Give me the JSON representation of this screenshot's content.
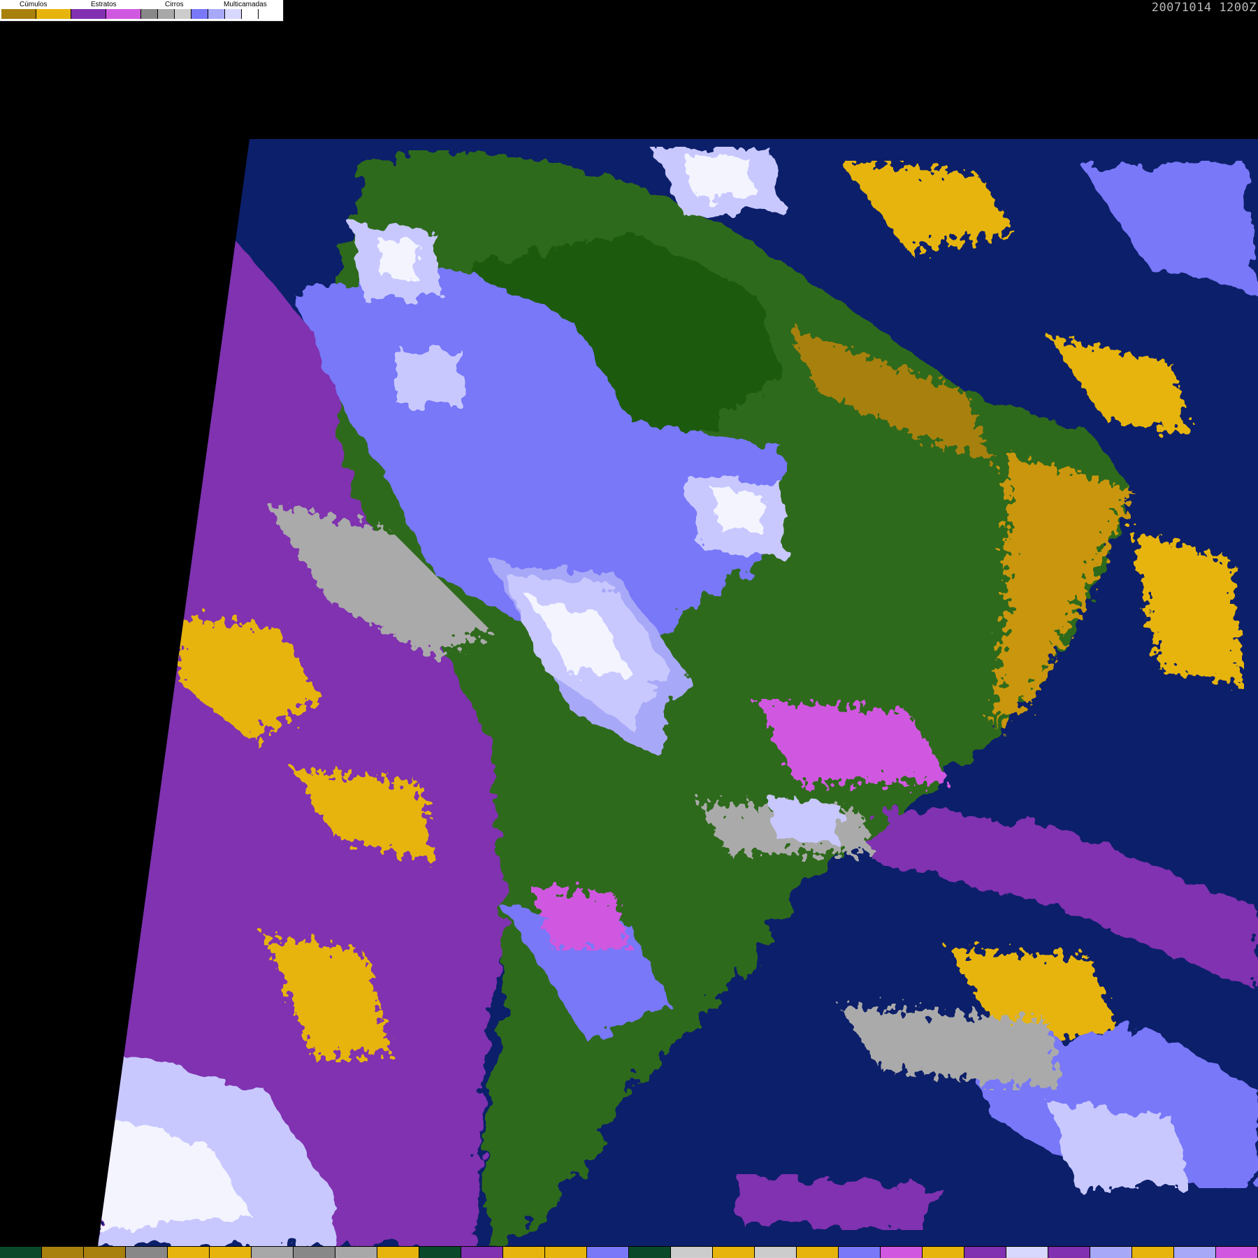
{
  "legend": {
    "groups": [
      {
        "label": "Cúmulos",
        "colors": [
          "#a8800c",
          "#e6b40c"
        ]
      },
      {
        "label": "Estratos",
        "colors": [
          "#8030b0",
          "#d058e0"
        ]
      },
      {
        "label": "Cirros",
        "colors": [
          "#888888",
          "#a8a8a8",
          "#cccccc"
        ]
      },
      {
        "label": "Multicamadas",
        "colors": [
          "#7878f8",
          "#a8a8f8",
          "#d8d8ff",
          "#ffffff"
        ]
      }
    ]
  },
  "timestamp": "20071014 1200Z",
  "palette": {
    "ocean": "#0c1f6a",
    "land": "#2f6a1e",
    "forest": "#1f5a10",
    "stratus": "#8030b0",
    "stratus_light": "#d058e0",
    "cumulus": "#e6b40c",
    "cumulus_dark": "#a8800c",
    "cirrus": "#aaaaaa",
    "multi": "#7878f8",
    "multi_light": "#c8c8ff",
    "cloud_white": "#f4f4ff",
    "background": "#000000"
  },
  "bottom_strip": [
    "#0a4a2a",
    "#a8800c",
    "#a8800c",
    "#888888",
    "#e6b40c",
    "#e6b40c",
    "#a8a8a8",
    "#888888",
    "#a8a8a8",
    "#e6b40c",
    "#0a4a2a",
    "#8030b0",
    "#e6b40c",
    "#e6b40c",
    "#7878f8",
    "#0a4a2a",
    "#cccccc",
    "#e6b40c",
    "#cccccc",
    "#e6b40c",
    "#7878f8",
    "#d058e0",
    "#e6b40c",
    "#8030b0",
    "#d8d8ff",
    "#8030b0",
    "#a8a8f8",
    "#e6b40c",
    "#a8a8f8",
    "#d058e0"
  ]
}
